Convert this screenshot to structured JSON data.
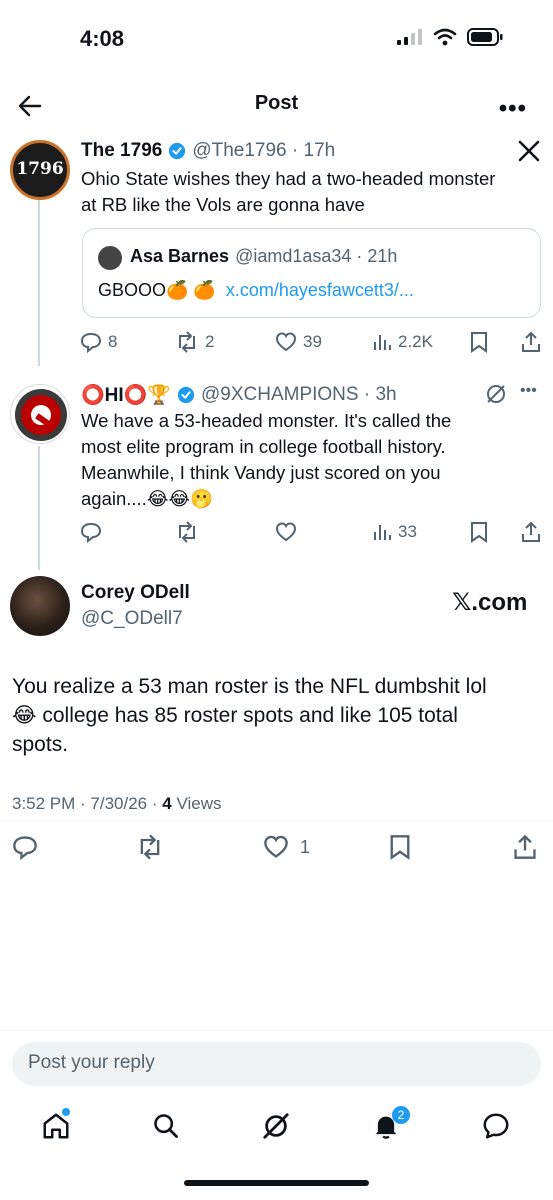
{
  "status_bar": {
    "time": "4:08"
  },
  "header": {
    "title": "Post"
  },
  "tweet1": {
    "name": "The 1796",
    "handle": "@The1796 · 17h",
    "avatar_text": "1796",
    "text_line1": "Ohio State wishes they had a two-headed monster",
    "text_line2": "at RB like the Vols are gonna have",
    "quote": {
      "name": "Asa Barnes",
      "handle": "@iamd1asa34 · 21h",
      "text": "GBOOO🍊 🍊",
      "link": "x.com/hayesfawcett3/..."
    },
    "replies": "8",
    "reposts": "2",
    "likes": "39",
    "views": "2.2K"
  },
  "tweet2": {
    "name": "⭕HI⭕🏆",
    "handle": "@9XCHAMPIONS · 3h",
    "text_line1": "We have a 53-headed monster.  It's called the",
    "text_line2": "most elite program in college football history.",
    "text_line3": "Meanwhile, I think Vandy just scored on you",
    "text_line4": "again....😂😂🫢",
    "views": "33"
  },
  "main_tweet": {
    "name": "Corey ODell",
    "handle": "@C_ODell7",
    "watermark": "𝕏.com",
    "text_line1": "You realize a 53 man roster is the NFL dumbshit lol",
    "text_line2": "😂 college has 85 roster spots and like 105 total",
    "text_line3": "spots.",
    "timestamp": "3:52 PM · 7/30/26 · ",
    "views_count": "4",
    "views_label": " Views",
    "likes": "1"
  },
  "reply": {
    "placeholder": "Post your reply"
  },
  "nav": {
    "notifications_badge": "2"
  },
  "colors": {
    "accent": "#1d9bf0",
    "muted": "#536471"
  }
}
